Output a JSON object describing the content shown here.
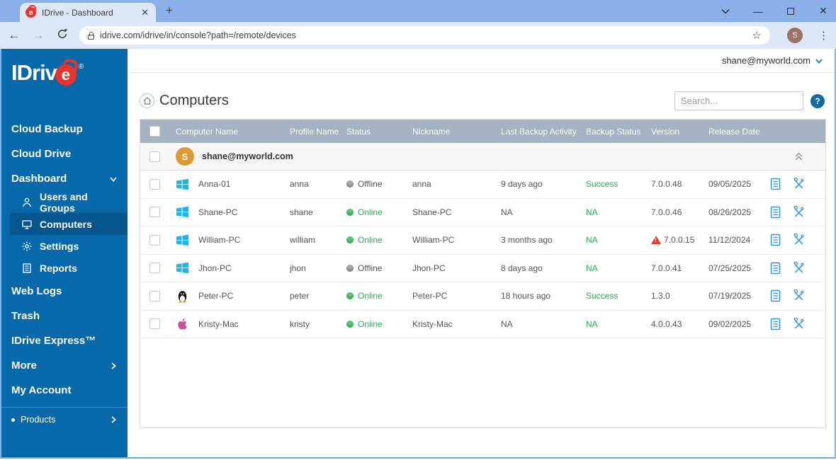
{
  "browser": {
    "tab_title": "IDrive - Dashboard",
    "url": "idrive.com/idrive/in/console?path=/remote/devices",
    "avatar_letter": "S"
  },
  "sidebar": {
    "logo_text": "IDriv",
    "logo_e": "e",
    "logo_reg": "®",
    "cloud_backup": "Cloud Backup",
    "cloud_drive": "Cloud Drive",
    "dashboard": "Dashboard",
    "users_and_groups": "Users and Groups",
    "computers": "Computers",
    "settings": "Settings",
    "reports": "Reports",
    "web_logs": "Web Logs",
    "trash": "Trash",
    "idrive_express": "IDrive Express™",
    "more": "More",
    "my_account": "My Account",
    "products": "Products"
  },
  "header": {
    "user_email": "shane@myworld.com",
    "page_title": "Computers",
    "help_label": "?"
  },
  "search": {
    "placeholder": "Search..."
  },
  "table": {
    "headers": [
      "Computer Name",
      "Profile Name",
      "Status",
      "Nickname",
      "Last Backup Activity",
      "Backup Status",
      "Version",
      "Release Date"
    ],
    "group": {
      "email": "shane@myworld.com",
      "avatar_letter": "S"
    },
    "rows": [
      {
        "os": "windows",
        "computer_name": "Anna-01",
        "profile_name": "anna",
        "status": "Offline",
        "nickname": "anna",
        "last_backup": "9 days ago",
        "backup_status": "Success",
        "version": "7.0.0.48",
        "version_warning": false,
        "release_date": "09/05/2025"
      },
      {
        "os": "windows",
        "computer_name": "Shane-PC",
        "profile_name": "shane",
        "status": "Online",
        "nickname": "Shane-PC",
        "last_backup": "NA",
        "backup_status": "NA",
        "version": "7.0.0.46",
        "version_warning": false,
        "release_date": "08/26/2025"
      },
      {
        "os": "windows",
        "computer_name": "William-PC",
        "profile_name": "william",
        "status": "Online",
        "nickname": "William-PC",
        "last_backup": "3 months ago",
        "backup_status": "NA",
        "version": "7.0.0.15",
        "version_warning": true,
        "release_date": "11/12/2024"
      },
      {
        "os": "windows",
        "computer_name": "Jhon-PC",
        "profile_name": "jhon",
        "status": "Offline",
        "nickname": "Jhon-PC",
        "last_backup": "8 days ago",
        "backup_status": "NA",
        "version": "7.0.0.41",
        "version_warning": false,
        "release_date": "07/25/2025"
      },
      {
        "os": "linux",
        "computer_name": "Peter-PC",
        "profile_name": "peter",
        "status": "Online",
        "nickname": "Peter-PC",
        "last_backup": "18 hours ago",
        "backup_status": "Success",
        "version": "1.3.0",
        "version_warning": false,
        "release_date": "07/19/2025"
      },
      {
        "os": "mac",
        "computer_name": "Kristy-Mac",
        "profile_name": "kristy",
        "status": "Online",
        "nickname": "Kristy-Mac",
        "last_backup": "NA",
        "backup_status": "NA",
        "version": "4.0.0.43",
        "version_warning": false,
        "release_date": "09/02/2025"
      }
    ]
  }
}
